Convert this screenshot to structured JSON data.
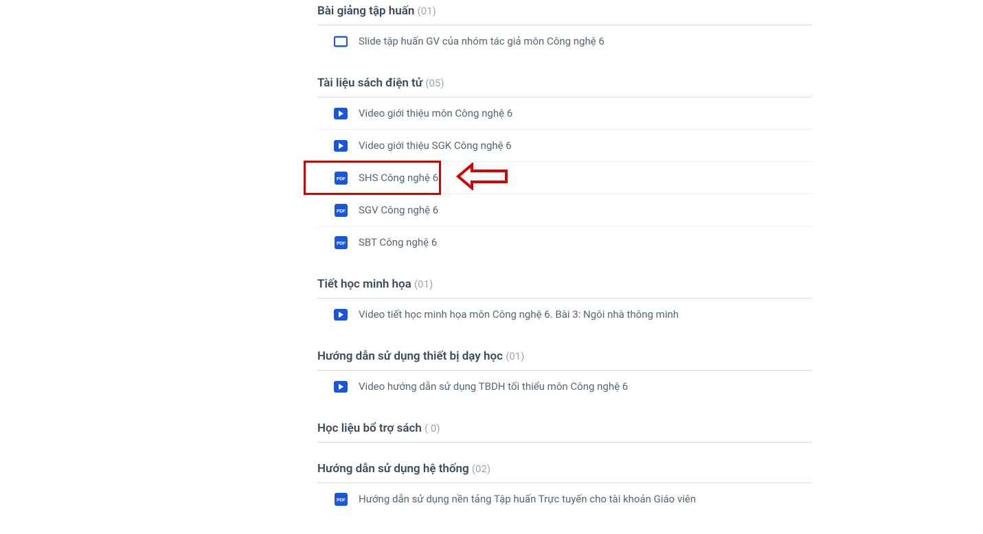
{
  "sections": [
    {
      "title": "Bài giảng tập huấn",
      "count": "(01)",
      "items": [
        {
          "icon": "slide",
          "label": "Slide tập huấn GV của nhóm tác giả môn Công nghệ 6",
          "highlighted": false
        }
      ]
    },
    {
      "title": "Tài liệu sách điện tử",
      "count": "(05)",
      "items": [
        {
          "icon": "video",
          "label": "Video giới thiệu môn Công nghệ 6",
          "highlighted": false
        },
        {
          "icon": "video",
          "label": "Video giới thiệu SGK Công nghệ 6",
          "highlighted": false
        },
        {
          "icon": "pdf",
          "label": "SHS Công nghệ 6",
          "highlighted": true
        },
        {
          "icon": "pdf",
          "label": "SGV Công nghệ 6",
          "highlighted": false
        },
        {
          "icon": "pdf",
          "label": "SBT Công nghệ 6",
          "highlighted": false
        }
      ]
    },
    {
      "title": "Tiết học minh họa",
      "count": "(01)",
      "items": [
        {
          "icon": "video",
          "label": "Video tiết học minh họa môn Công nghệ 6. Bài 3: Ngôi nhà thông minh",
          "highlighted": false
        }
      ]
    },
    {
      "title": "Hướng dẫn sử dụng thiết bị dạy học",
      "count": "(01)",
      "items": [
        {
          "icon": "video",
          "label": "Video hướng dẫn sử dụng TBDH tối thiểu môn Công nghệ 6",
          "highlighted": false
        }
      ]
    },
    {
      "title": "Học liệu bổ trợ sách",
      "count": "( 0)",
      "items": []
    },
    {
      "title": "Hướng dẫn sử dụng hệ thống",
      "count": "(02)",
      "items": [
        {
          "icon": "pdf",
          "label": "Hướng dẫn sử dụng nền tảng Tập huấn Trực tuyến cho tài khoản Giáo viên",
          "highlighted": false
        }
      ]
    }
  ]
}
